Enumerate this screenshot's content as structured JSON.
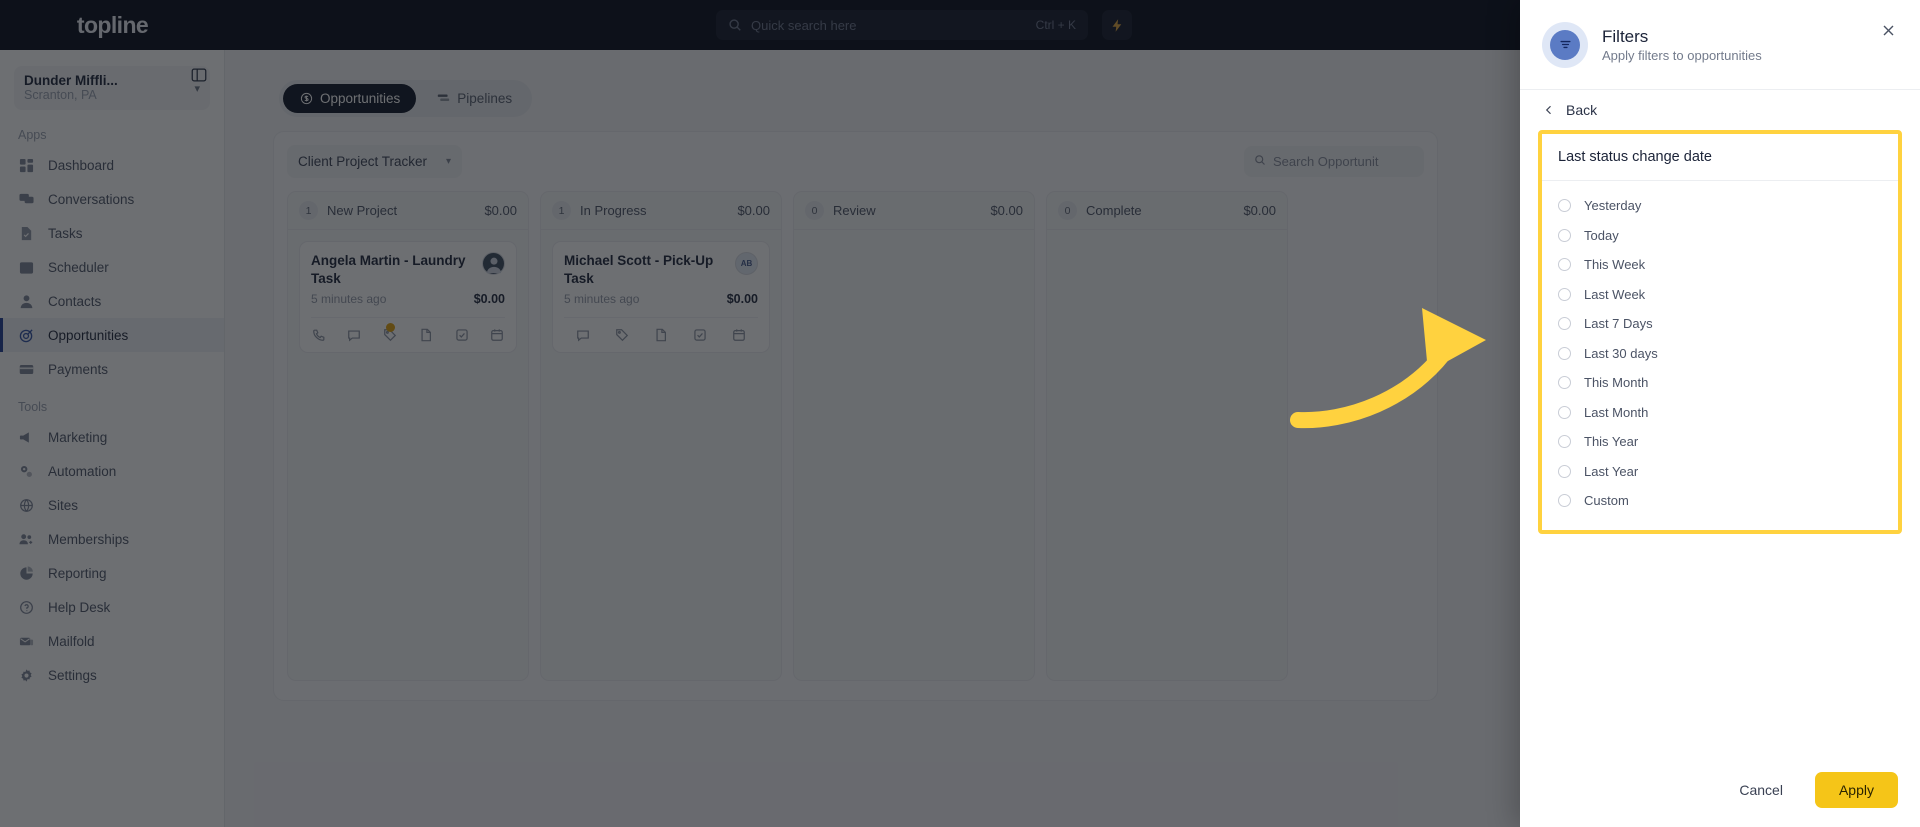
{
  "topbar": {
    "brand": "topline",
    "search": {
      "placeholder": "Quick search here",
      "value": "",
      "shortcut": "Ctrl + K",
      "icon": "search-icon"
    },
    "bolt_icon": "lightning-bolt-icon"
  },
  "sidebar": {
    "workspace": {
      "name": "Dunder Miffli...",
      "location": "Scranton, PA",
      "caret": "chevron-down-icon"
    },
    "panel_toggle_icon": "sidebar-collapse-icon",
    "sections": [
      {
        "label": "Apps",
        "items": [
          {
            "label": "Dashboard",
            "icon": "dashboard-icon",
            "active": false
          },
          {
            "label": "Conversations",
            "icon": "chat-icon",
            "active": false
          },
          {
            "label": "Tasks",
            "icon": "task-icon",
            "active": false
          },
          {
            "label": "Scheduler",
            "icon": "calendar-icon",
            "active": false
          },
          {
            "label": "Contacts",
            "icon": "person-icon",
            "active": false
          },
          {
            "label": "Opportunities",
            "icon": "target-icon",
            "active": true
          },
          {
            "label": "Payments",
            "icon": "card-icon",
            "active": false
          }
        ]
      },
      {
        "label": "Tools",
        "items": [
          {
            "label": "Marketing",
            "icon": "megaphone-icon",
            "active": false
          },
          {
            "label": "Automation",
            "icon": "gears-icon",
            "active": false
          },
          {
            "label": "Sites",
            "icon": "globe-icon",
            "active": false
          },
          {
            "label": "Memberships",
            "icon": "users-plus-icon",
            "active": false
          },
          {
            "label": "Reporting",
            "icon": "pie-chart-icon",
            "active": false
          },
          {
            "label": "Help Desk",
            "icon": "question-circle-icon",
            "active": false
          },
          {
            "label": "Mailfold",
            "icon": "mail-stack-icon",
            "active": false
          },
          {
            "label": "Settings",
            "icon": "gear-icon",
            "active": false
          }
        ]
      }
    ]
  },
  "main": {
    "tabs": [
      {
        "label": "Opportunities",
        "icon": "dollar-circle-icon",
        "active": true
      },
      {
        "label": "Pipelines",
        "icon": "pipeline-icon",
        "active": false
      }
    ],
    "pipeline_select": {
      "value": "Client Project Tracker",
      "caret": "chevron-down-icon"
    },
    "board_search": {
      "placeholder": "Search Opportunit",
      "value": "",
      "icon": "search-icon"
    },
    "columns": [
      {
        "count": "1",
        "name": "New Project",
        "total": "$0.00",
        "cards": [
          {
            "title": "Angela Martin - Laundry Task",
            "time": "5 minutes ago",
            "amount": "$0.00",
            "avatar": "photo-avatar",
            "avatar_initials": "",
            "actions": [
              "phone-icon",
              "chat-icon",
              "tag-icon",
              "note-icon",
              "task-icon",
              "calendar-icon"
            ],
            "badge_dot": true
          }
        ]
      },
      {
        "count": "1",
        "name": "In Progress",
        "total": "$0.00",
        "cards": [
          {
            "title": "Michael Scott - Pick-Up Task",
            "time": "5 minutes ago",
            "amount": "$0.00",
            "avatar": "initials-avatar",
            "avatar_initials": "AB",
            "actions": [
              "chat-icon",
              "tag-icon",
              "note-icon",
              "task-icon",
              "calendar-icon"
            ],
            "badge_dot": false
          }
        ]
      },
      {
        "count": "0",
        "name": "Review",
        "total": "$0.00",
        "cards": []
      },
      {
        "count": "0",
        "name": "Complete",
        "total": "$0.00",
        "cards": []
      }
    ]
  },
  "drawer": {
    "icon": "filter-icon",
    "title": "Filters",
    "subtitle": "Apply filters to opportunities",
    "close_icon": "close-icon",
    "back": {
      "label": "Back",
      "icon": "chevron-left-icon"
    },
    "filter_group": {
      "title": "Last status change date",
      "options": [
        {
          "label": "Yesterday",
          "selected": false
        },
        {
          "label": "Today",
          "selected": false
        },
        {
          "label": "This Week",
          "selected": false
        },
        {
          "label": "Last Week",
          "selected": false
        },
        {
          "label": "Last 7 Days",
          "selected": false
        },
        {
          "label": "Last 30 days",
          "selected": false
        },
        {
          "label": "This Month",
          "selected": false
        },
        {
          "label": "Last Month",
          "selected": false
        },
        {
          "label": "This Year",
          "selected": false
        },
        {
          "label": "Last Year",
          "selected": false
        },
        {
          "label": "Custom",
          "selected": false
        }
      ]
    },
    "cancel_label": "Cancel",
    "apply_label": "Apply"
  },
  "annotation": {
    "arrow_icon": "curved-arrow-icon",
    "highlight_color": "#ffd23f"
  }
}
